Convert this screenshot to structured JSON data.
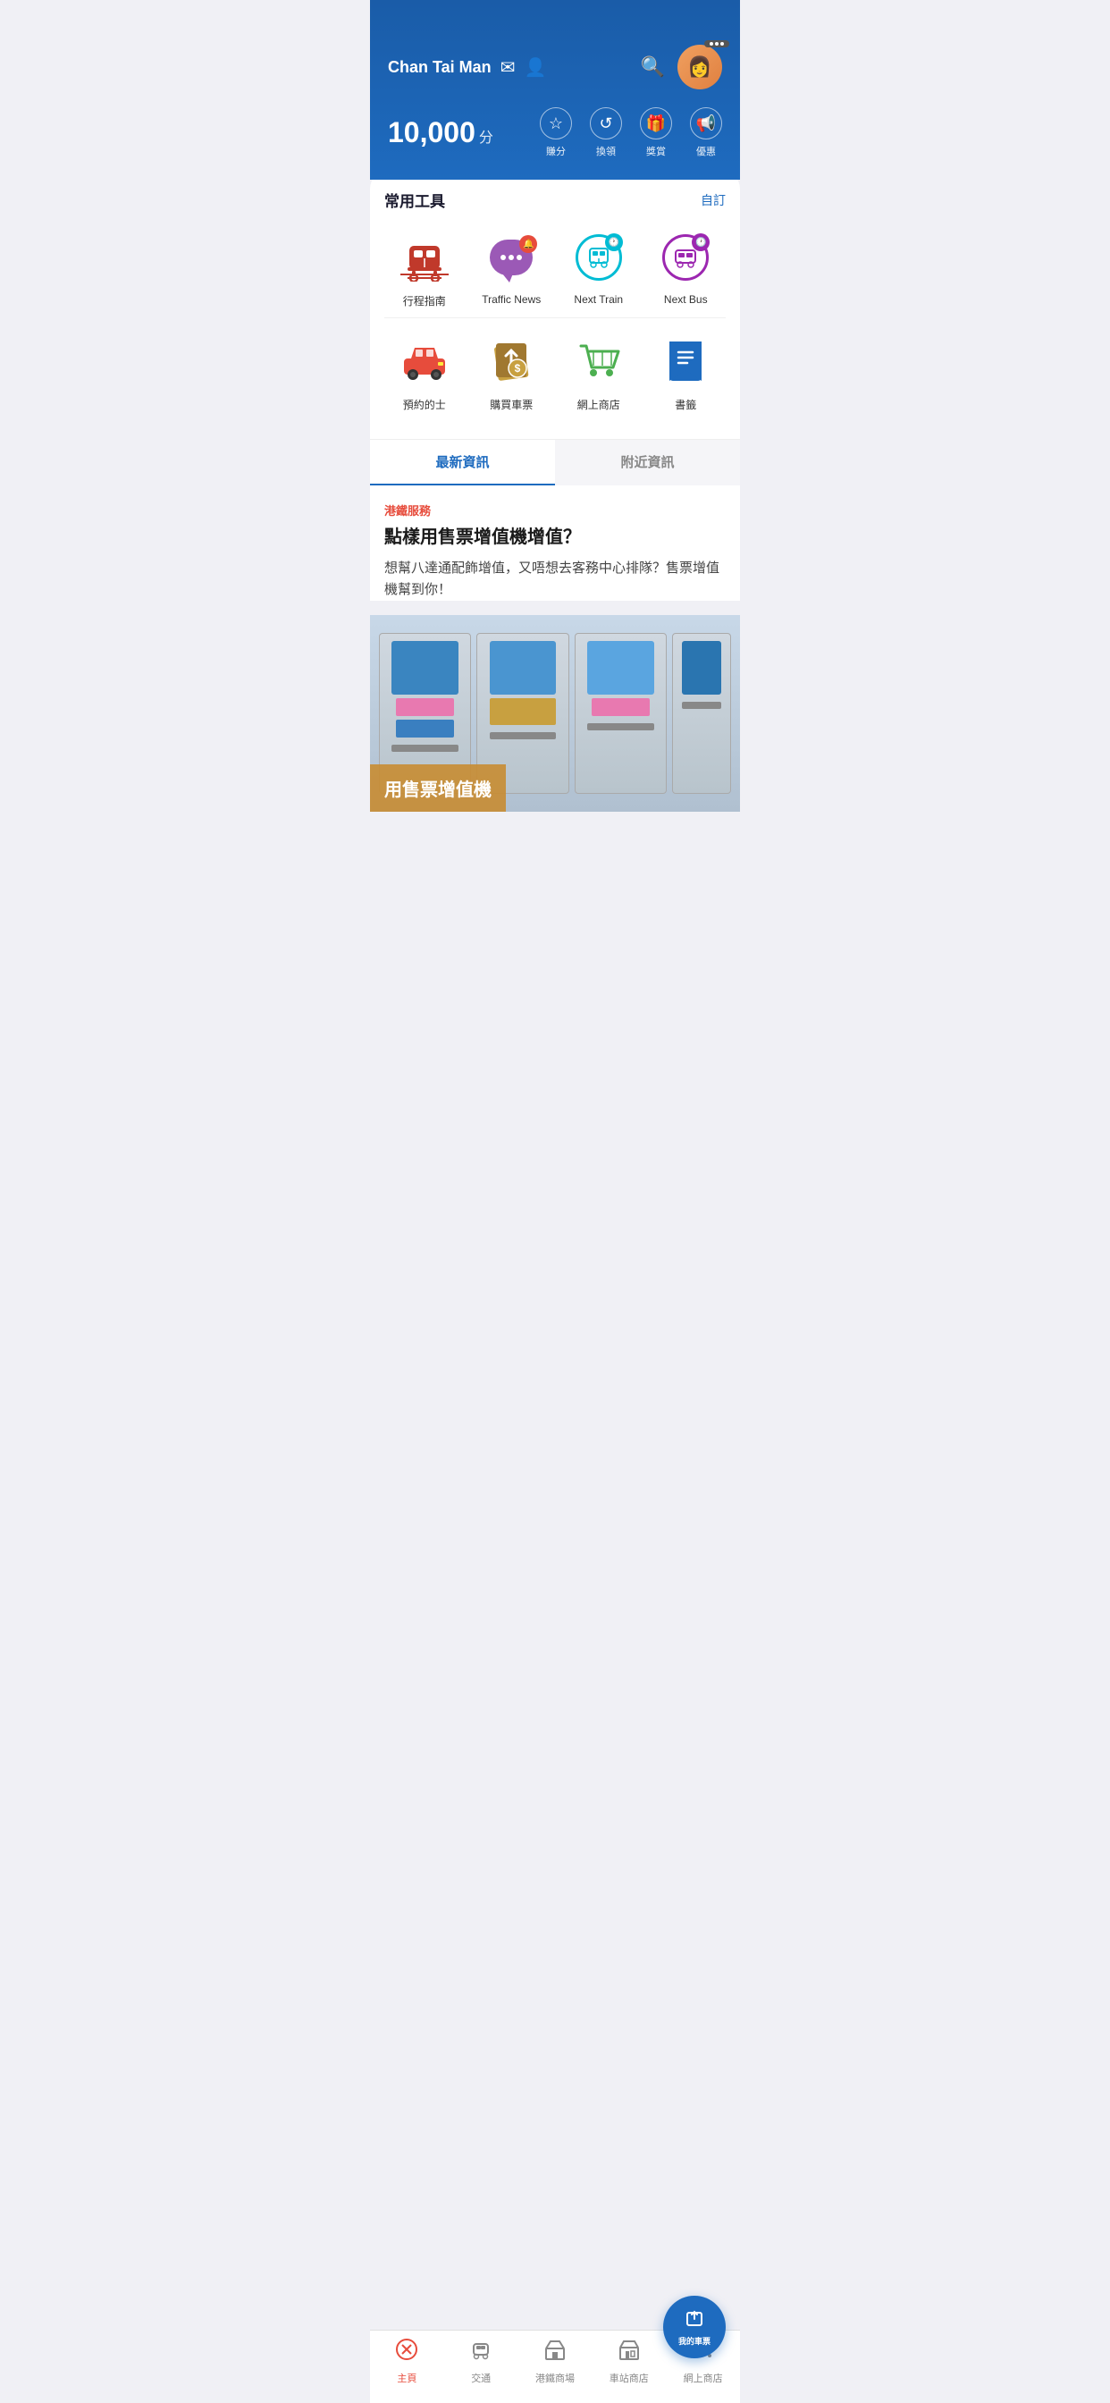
{
  "header": {
    "username": "Chan Tai Man",
    "mail_icon": "✉",
    "profile_icon": "👤",
    "points": "10,000",
    "points_unit": "分",
    "actions": [
      {
        "icon": "☆",
        "label": "賺分"
      },
      {
        "icon": "↺",
        "label": "換領"
      },
      {
        "icon": "🎁",
        "label": "獎賞"
      },
      {
        "icon": "📢",
        "label": "優惠"
      }
    ]
  },
  "tools": {
    "section_title": "常用工具",
    "customize_label": "自訂",
    "items_row1": [
      {
        "id": "journey",
        "label": "行程指南",
        "icon_type": "train"
      },
      {
        "id": "traffic",
        "label": "Traffic News",
        "icon_type": "traffic"
      },
      {
        "id": "next-train",
        "label": "Next Train",
        "icon_type": "next-train"
      },
      {
        "id": "next-bus",
        "label": "Next Bus",
        "icon_type": "next-bus"
      }
    ],
    "items_row2": [
      {
        "id": "taxi",
        "label": "預約的士",
        "icon_type": "taxi"
      },
      {
        "id": "ticket",
        "label": "購買車票",
        "icon_type": "ticket"
      },
      {
        "id": "shop",
        "label": "網上商店",
        "icon_type": "shop"
      },
      {
        "id": "bookmark",
        "label": "書籤",
        "icon_type": "bookmark"
      }
    ]
  },
  "news_tabs": {
    "tab1": "最新資訊",
    "tab2": "附近資訊",
    "active": "tab1"
  },
  "news": {
    "category": "港鐵服務",
    "title": "點樣用售票增值機增值？",
    "description": "想幫八達通配飾增值，又唔想去客務中心排隊？售票增值機幫到你！",
    "image_text": "用售票增值機"
  },
  "bottom_nav": {
    "items": [
      {
        "id": "home",
        "label": "主頁",
        "icon": "✕",
        "active": true
      },
      {
        "id": "transport",
        "label": "交通",
        "icon": "🚇",
        "active": false
      },
      {
        "id": "mall",
        "label": "港鐵商場",
        "icon": "🏬",
        "active": false
      },
      {
        "id": "station-shop",
        "label": "車站商店",
        "icon": "🏪",
        "active": false
      },
      {
        "id": "online-shop",
        "label": "網上商店",
        "icon": "🛒",
        "active": false
      }
    ],
    "fab_label": "我的車票"
  }
}
